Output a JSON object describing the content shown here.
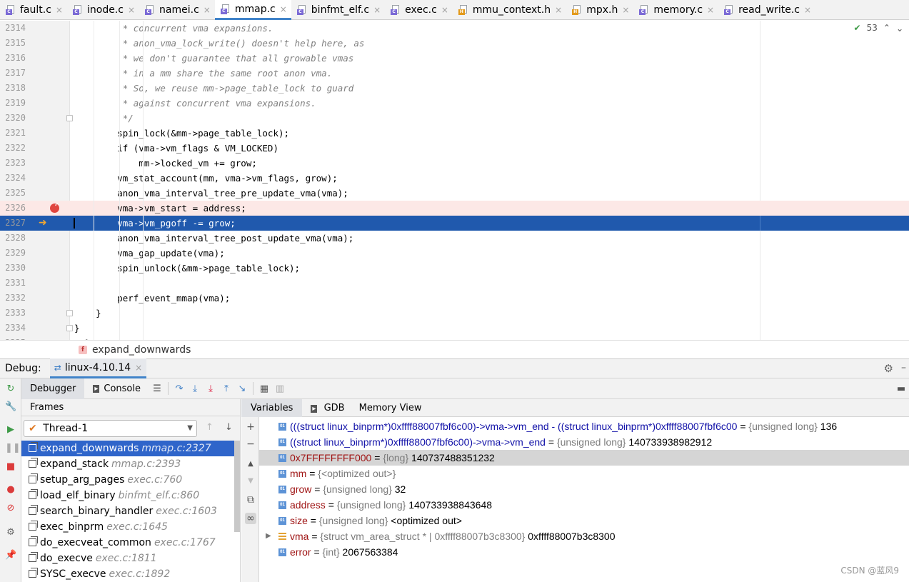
{
  "tabs": [
    {
      "label": "fault.c",
      "kind": "c",
      "active": false
    },
    {
      "label": "inode.c",
      "kind": "c",
      "active": false
    },
    {
      "label": "namei.c",
      "kind": "c",
      "active": false
    },
    {
      "label": "mmap.c",
      "kind": "c",
      "active": true
    },
    {
      "label": "binfmt_elf.c",
      "kind": "c",
      "active": false
    },
    {
      "label": "exec.c",
      "kind": "c",
      "active": false
    },
    {
      "label": "mmu_context.h",
      "kind": "h",
      "active": false
    },
    {
      "label": "mpx.h",
      "kind": "h",
      "active": false
    },
    {
      "label": "memory.c",
      "kind": "c",
      "active": false
    },
    {
      "label": "read_write.c",
      "kind": "c",
      "active": false
    }
  ],
  "editor": {
    "inspection_count": "53",
    "lines": [
      {
        "n": "2314",
        "text": "         * concurrent vma expansions.",
        "comment": true
      },
      {
        "n": "2315",
        "text": "         * anon_vma_lock_write() doesn't help here, as",
        "comment": true
      },
      {
        "n": "2316",
        "text": "         * we don't guarantee that all growable vmas",
        "comment": true
      },
      {
        "n": "2317",
        "text": "         * in a mm share the same root anon vma.",
        "comment": true
      },
      {
        "n": "2318",
        "text": "         * So, we reuse mm->page_table_lock to guard",
        "comment": true
      },
      {
        "n": "2319",
        "text": "         * against concurrent vma expansions.",
        "comment": true
      },
      {
        "n": "2320",
        "text": "         */",
        "comment": true,
        "fold": true
      },
      {
        "n": "2321",
        "text": "        spin_lock(&mm->page_table_lock);"
      },
      {
        "n": "2322",
        "text": "        if (vma->vm_flags & VM_LOCKED)"
      },
      {
        "n": "2323",
        "text": "            mm->locked_vm += grow;"
      },
      {
        "n": "2324",
        "text": "        vm_stat_account(mm, vma->vm_flags, grow);"
      },
      {
        "n": "2325",
        "text": "        anon_vma_interval_tree_pre_update_vma(vma);"
      },
      {
        "n": "2326",
        "text": "        vma->vm_start = address;",
        "breakpoint": true
      },
      {
        "n": "2327",
        "text": "        vma->vm_pgoff -= grow;",
        "current": true
      },
      {
        "n": "2328",
        "text": "        anon_vma_interval_tree_post_update_vma(vma);"
      },
      {
        "n": "2329",
        "text": "        vma_gap_update(vma);"
      },
      {
        "n": "2330",
        "text": "        spin_unlock(&mm->page_table_lock);"
      },
      {
        "n": "2331",
        "text": ""
      },
      {
        "n": "2332",
        "text": "        perf_event_mmap(vma);"
      },
      {
        "n": "2333",
        "text": "    }",
        "fold": true
      },
      {
        "n": "2334",
        "text": "}",
        "fold": true
      },
      {
        "n": "2335",
        "text": "  }"
      }
    ]
  },
  "breadcrumb": {
    "label": "expand_downwards"
  },
  "debug": {
    "label": "Debug:",
    "session": "linux-4.10.14",
    "tabs": {
      "debugger": "Debugger",
      "console": "Console"
    },
    "frames_header": "Frames",
    "thread": "Thread-1",
    "frames": [
      {
        "name": "expand_downwards",
        "loc": "mmap.c:2327",
        "selected": true
      },
      {
        "name": "expand_stack",
        "loc": "mmap.c:2393"
      },
      {
        "name": "setup_arg_pages",
        "loc": "exec.c:760"
      },
      {
        "name": "load_elf_binary",
        "loc": "binfmt_elf.c:860"
      },
      {
        "name": "search_binary_handler",
        "loc": "exec.c:1603"
      },
      {
        "name": "exec_binprm",
        "loc": "exec.c:1645"
      },
      {
        "name": "do_execveat_common",
        "loc": "exec.c:1767"
      },
      {
        "name": "do_execve",
        "loc": "exec.c:1811"
      },
      {
        "name": "SYSC_execve",
        "loc": "exec.c:1892"
      }
    ],
    "var_tabs": {
      "variables": "Variables",
      "gdb": "GDB",
      "memory": "Memory View"
    },
    "variables": [
      {
        "kind": "watch",
        "name": "(((struct linux_binprm*)0xffff88007fbf6c00)->vma->vm_end - ((struct linux_binprm*)0xffff88007fbf6c00",
        "eq": " = ",
        "type": "{unsigned long}",
        "value": " 136"
      },
      {
        "kind": "watch2",
        "name": "((struct linux_binprm*)0xffff88007fbf6c00)->vma->vm_end ",
        "eq": " = ",
        "type": "{unsigned long}",
        "value": " 140733938982912"
      },
      {
        "kind": "selected",
        "name": "0x7FFFFFFFF000",
        "eq": " = ",
        "type": "{long}",
        "value": " 140737488351232"
      },
      {
        "kind": "var",
        "name": "mm",
        "eq": " = ",
        "type": "{<optimized out>}",
        "value": ""
      },
      {
        "kind": "var",
        "name": "grow",
        "eq": " = ",
        "type": "{unsigned long}",
        "value": " 32"
      },
      {
        "kind": "var",
        "name": "address",
        "eq": " = ",
        "type": "{unsigned long}",
        "value": " 140733938843648"
      },
      {
        "kind": "var",
        "name": "size",
        "eq": " = ",
        "type": "{unsigned long}",
        "value": " <optimized out>"
      },
      {
        "kind": "struct",
        "name": "vma",
        "eq": " = ",
        "type": "{struct vm_area_struct * | 0xffff88007b3c8300}",
        "value": " 0xffff88007b3c8300"
      },
      {
        "kind": "var",
        "name": "error",
        "eq": " = ",
        "type": "{int}",
        "value": " 2067563384"
      }
    ]
  },
  "watermark": "CSDN @蓝风9"
}
